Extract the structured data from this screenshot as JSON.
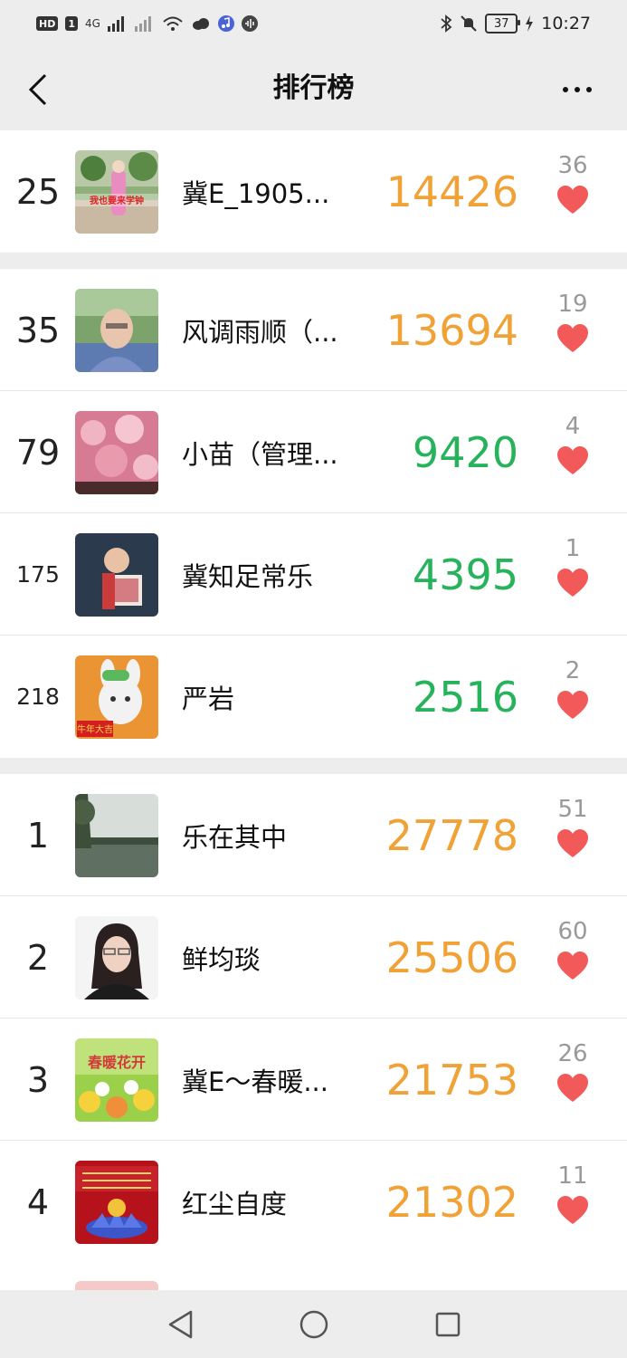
{
  "status_bar": {
    "left_chips": [
      "HD",
      "1"
    ],
    "network": "4G",
    "time": "10:27",
    "battery": "37"
  },
  "header": {
    "title": "排行榜"
  },
  "groups": [
    {
      "rows": [
        {
          "rank": "25",
          "name": "冀E_1905...",
          "steps": "14426",
          "likes": "36",
          "color": "orange"
        }
      ]
    },
    {
      "rows": [
        {
          "rank": "35",
          "name": "风调雨顺（...",
          "steps": "13694",
          "likes": "19",
          "color": "orange"
        },
        {
          "rank": "79",
          "name": "小苗（管理...",
          "steps": "9420",
          "likes": "4",
          "color": "green"
        },
        {
          "rank": "175",
          "name": "冀知足常乐",
          "steps": "4395",
          "likes": "1",
          "color": "green"
        },
        {
          "rank": "218",
          "name": "严岩",
          "steps": "2516",
          "likes": "2",
          "color": "green"
        }
      ]
    },
    {
      "rows": [
        {
          "rank": "1",
          "name": "乐在其中",
          "steps": "27778",
          "likes": "51",
          "color": "orange"
        },
        {
          "rank": "2",
          "name": "鲜均琰",
          "steps": "25506",
          "likes": "60",
          "color": "orange"
        },
        {
          "rank": "3",
          "name": "冀E～春暖...",
          "steps": "21753",
          "likes": "26",
          "color": "orange"
        },
        {
          "rank": "4",
          "name": "红尘自度",
          "steps": "21302",
          "likes": "11",
          "color": "orange"
        }
      ]
    }
  ],
  "avatar_text": {
    "row0": "我也要来学钟",
    "row4": "牛年大吉",
    "row7": "春暖花开"
  },
  "colors": {
    "orange": "#f0a236",
    "green": "#27b35b",
    "heart": "#f25a5a",
    "background": "#ededed"
  },
  "icons": {
    "back": "chevron-left-icon",
    "more": "more-dots-icon",
    "like": "heart-icon",
    "nav_back": "triangle-back-icon",
    "nav_home": "circle-home-icon",
    "nav_recent": "square-recent-icon"
  }
}
